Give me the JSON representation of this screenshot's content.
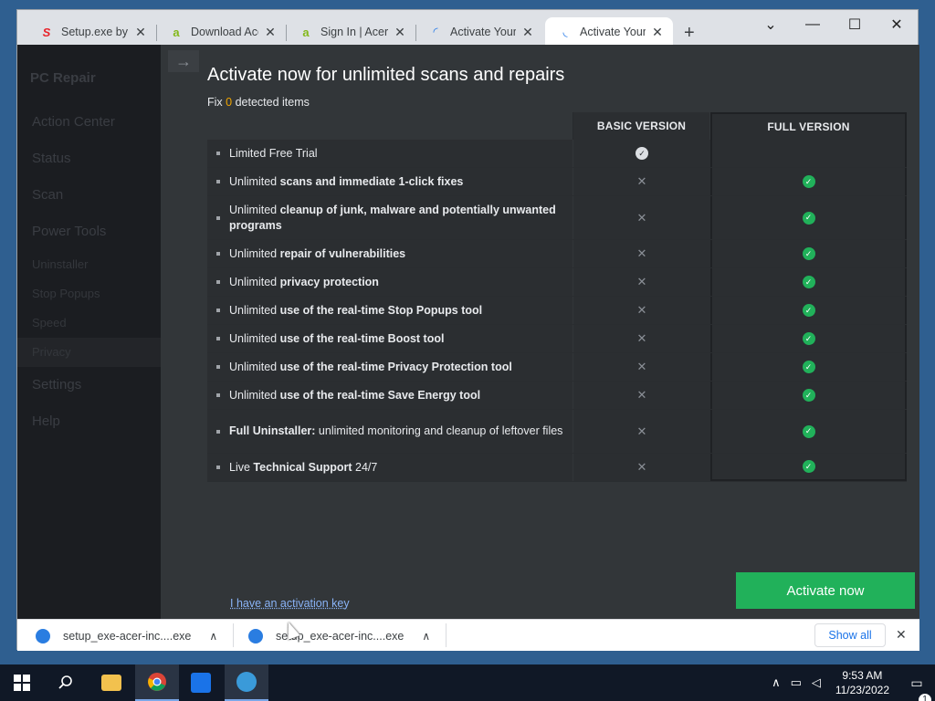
{
  "browser": {
    "tabs": [
      {
        "title": "Setup.exe by A",
        "icon": "avast-brand-icon",
        "color": "#e8232a"
      },
      {
        "title": "Download Ace",
        "icon": "acer-brand-icon",
        "color": "#83b81a"
      },
      {
        "title": "Sign In | Acer I",
        "icon": "acer-brand-icon",
        "color": "#83b81a"
      },
      {
        "title": "Activate Your C",
        "icon": "loading-icon",
        "color": "#1a73e8"
      },
      {
        "title": "Activate Your C",
        "icon": "loading-icon",
        "color": "#1a73e8"
      }
    ],
    "new_tab": "+",
    "controls": {
      "dropdown": "⌄",
      "minimize": "—",
      "maximize": "☐",
      "close": "✕"
    }
  },
  "sidebar": {
    "app_name": "PC Repair",
    "items": [
      "Action Center",
      "Status",
      "Scan",
      "Power Tools",
      "Settings",
      "Help"
    ],
    "sub_items": [
      "Uninstaller",
      "Stop Popups",
      "Speed",
      "Privacy"
    ]
  },
  "modal": {
    "back": "→",
    "title": "Activate now for unlimited scans and repairs",
    "fix_prefix": "Fix",
    "fix_count": "0",
    "fix_suffix": "detected items",
    "headers": {
      "basic": "BASIC VERSION",
      "full": "FULL VERSION"
    },
    "rows": [
      {
        "pre": "Limited Free Trial",
        "bold": "",
        "post": "",
        "basic": "check",
        "full": "none"
      },
      {
        "pre": "Unlimited ",
        "bold": "scans and immediate 1-click fixes",
        "post": "",
        "basic": "x",
        "full": "check"
      },
      {
        "pre": "Unlimited ",
        "bold": "cleanup of junk, malware and potentially unwanted programs",
        "post": "",
        "basic": "x",
        "full": "check"
      },
      {
        "pre": "Unlimited ",
        "bold": "repair of vulnerabilities",
        "post": "",
        "basic": "x",
        "full": "check"
      },
      {
        "pre": "Unlimited ",
        "bold": "privacy protection",
        "post": "",
        "basic": "x",
        "full": "check"
      },
      {
        "pre": "Unlimited ",
        "bold": "use of the real-time Stop Popups tool",
        "post": "",
        "basic": "x",
        "full": "check"
      },
      {
        "pre": "Unlimited ",
        "bold": "use of the real-time Boost tool",
        "post": "",
        "basic": "x",
        "full": "check"
      },
      {
        "pre": "Unlimited ",
        "bold": "use of the real-time Privacy Protection tool",
        "post": "",
        "basic": "x",
        "full": "check"
      },
      {
        "pre": "Unlimited ",
        "bold": "use of the real-time Save Energy tool",
        "post": "",
        "basic": "x",
        "full": "check"
      },
      {
        "pre": "",
        "bold": "Full Uninstaller:",
        "post": " unlimited monitoring and cleanup of leftover files",
        "basic": "x",
        "full": "check"
      },
      {
        "pre": "Live ",
        "bold": "Technical Support",
        "post": " 24/7",
        "basic": "x",
        "full": "check"
      }
    ],
    "activation_key_link": "I have an activation key",
    "activate_button": "Activate now"
  },
  "downloads": {
    "items": [
      "setup_exe-acer-inc....exe",
      "setup_exe-acer-inc....exe"
    ],
    "show_all": "Show all",
    "close": "✕"
  },
  "taskbar": {
    "time": "9:53 AM",
    "date": "11/23/2022",
    "notifications": "1"
  }
}
